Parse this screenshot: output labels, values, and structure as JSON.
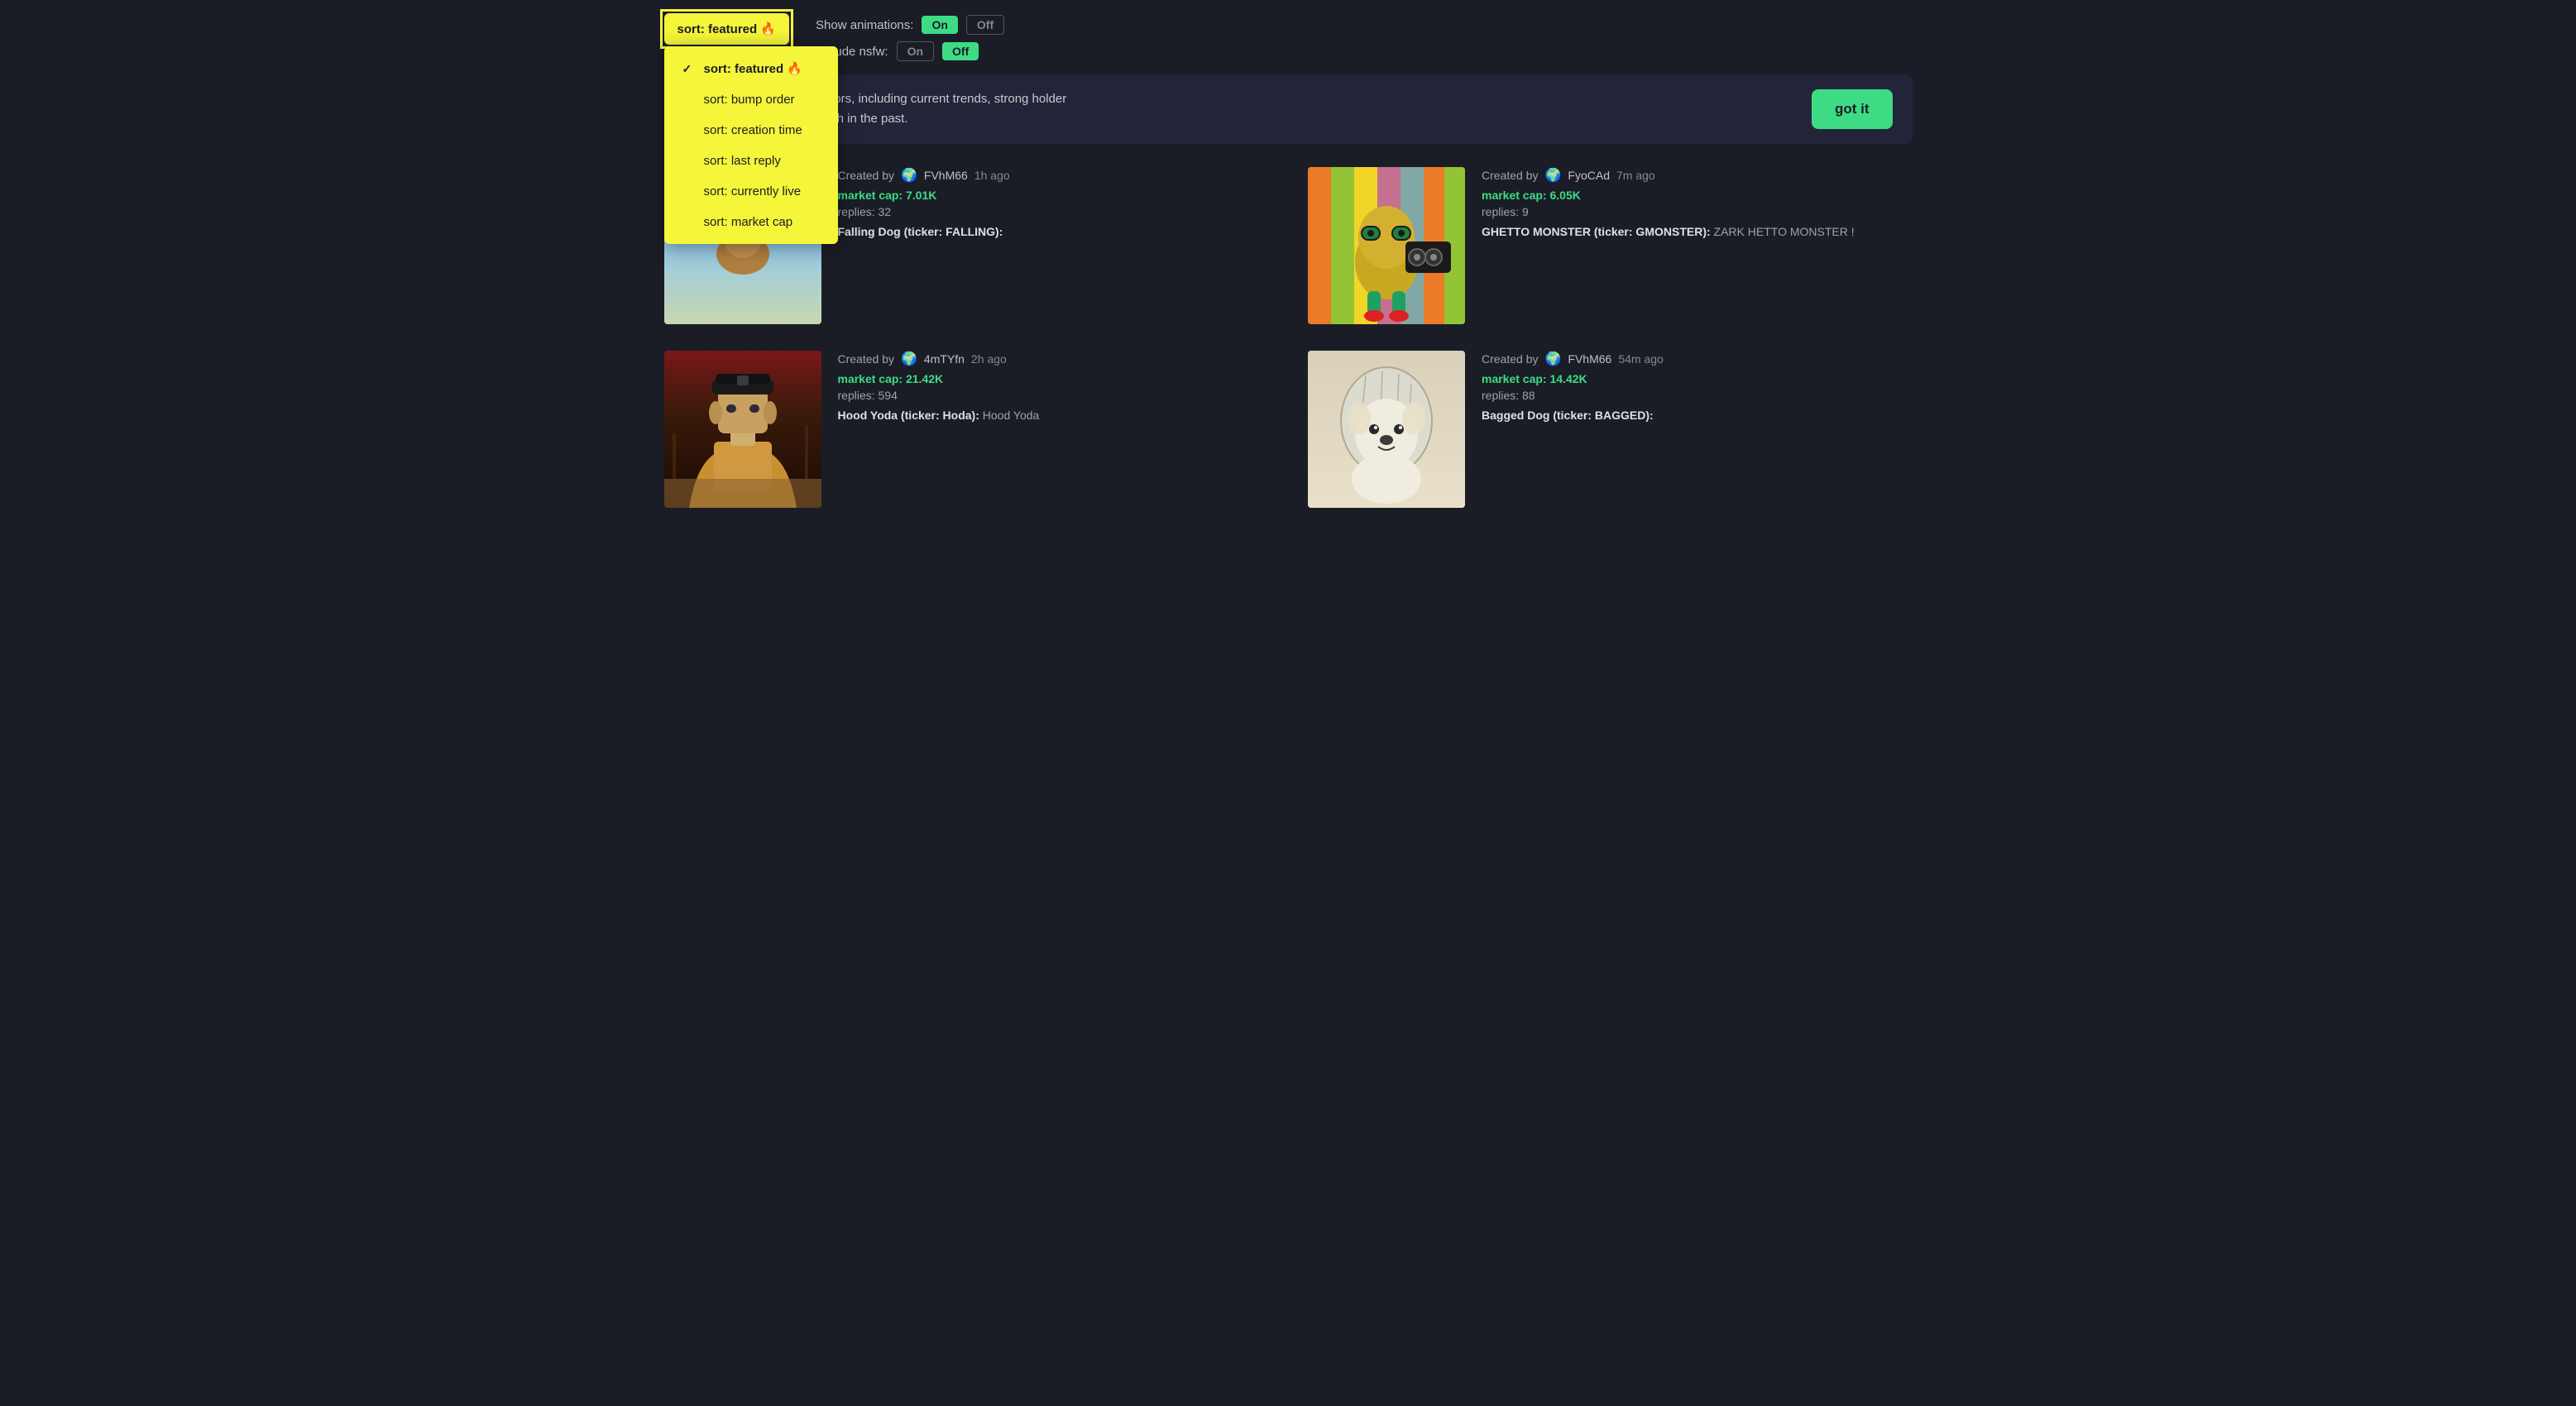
{
  "sort": {
    "button_label": "sort: featured 🔥",
    "selected": "featured",
    "options": [
      {
        "id": "featured",
        "label": "sort: featured 🔥",
        "selected": true
      },
      {
        "id": "bump_order",
        "label": "sort: bump order",
        "selected": false
      },
      {
        "id": "creation_time",
        "label": "sort: creation time",
        "selected": false
      },
      {
        "id": "last_reply",
        "label": "sort: last reply",
        "selected": false
      },
      {
        "id": "currently_live",
        "label": "sort: currently live",
        "selected": false
      },
      {
        "id": "market_cap",
        "label": "sort: market cap",
        "selected": false
      }
    ]
  },
  "animations": {
    "label": "Show animations:",
    "on_label": "On",
    "off_label": "Off",
    "on_active": true
  },
  "nsfw": {
    "label": "Include nsfw:",
    "on_label": "On",
    "off_label": "Off",
    "off_active": true
  },
  "info_banner": {
    "text": "coins based on several factors, including current trends, strong holder\ncoins you have engaged with in the past.",
    "button_label": "got it"
  },
  "coins": [
    {
      "id": "falling-dog",
      "creator_label": "Created by",
      "creator_globe": "🌍",
      "creator_name": "FVhM66",
      "time_ago": "1h ago",
      "market_cap": "market cap: 7.01K",
      "replies": "replies: 32",
      "title": "Falling Dog (ticker: FALLING):",
      "description": "",
      "image_type": "falling-dog"
    },
    {
      "id": "ghetto-monster",
      "creator_label": "Created by",
      "creator_globe": "🌍",
      "creator_name": "FyoCAd",
      "time_ago": "7m ago",
      "market_cap": "market cap: 6.05K",
      "replies": "replies: 9",
      "title": "GHETTO MONSTER (ticker: GMONSTER):",
      "description": "ZARK HETTO MONSTER !",
      "image_type": "ghetto-monster"
    },
    {
      "id": "hood-yoda",
      "creator_label": "Created by",
      "creator_globe": "🌍",
      "creator_name": "4mTYfn",
      "time_ago": "2h ago",
      "market_cap": "market cap: 21.42K",
      "replies": "replies: 594",
      "title": "Hood Yoda (ticker: Hoda):",
      "description": "Hood Yoda",
      "image_type": "hood-yoda"
    },
    {
      "id": "bagged-dog",
      "creator_label": "Created by",
      "creator_globe": "🌍",
      "creator_name": "FVhM66",
      "time_ago": "54m ago",
      "market_cap": "market cap: 14.42K",
      "replies": "replies: 88",
      "title": "Bagged Dog (ticker: BAGGED):",
      "description": "",
      "image_type": "bagged-dog"
    }
  ]
}
